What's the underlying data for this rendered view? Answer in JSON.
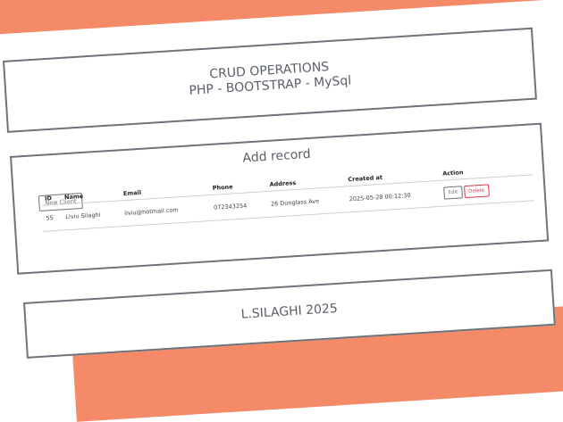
{
  "header": {
    "title_line1": "CRUD OPERATIONS",
    "title_line2": "PHP - BOOTSTRAP - MySql"
  },
  "records": {
    "subtitle": "Add record",
    "new_client_label": "New Client",
    "columns": {
      "id": "ID",
      "name": "Name",
      "email": "Email",
      "phone": "Phone",
      "address": "Address",
      "created": "Created at",
      "action": "Action"
    },
    "rows": [
      {
        "id": "55",
        "name": "Liviu Silaghi",
        "email": "liviu@hotmail.com",
        "phone": "072343254",
        "address": "26 Dunglass Ave",
        "created": "2025-05-28 00:12:30",
        "edit_label": "Edit",
        "delete_label": "Delete"
      }
    ]
  },
  "footer": {
    "text": "L.SILAGHI 2025"
  },
  "colors": {
    "accent_stripe": "#f58a68",
    "border": "#6d737a",
    "danger": "#dc3545"
  }
}
